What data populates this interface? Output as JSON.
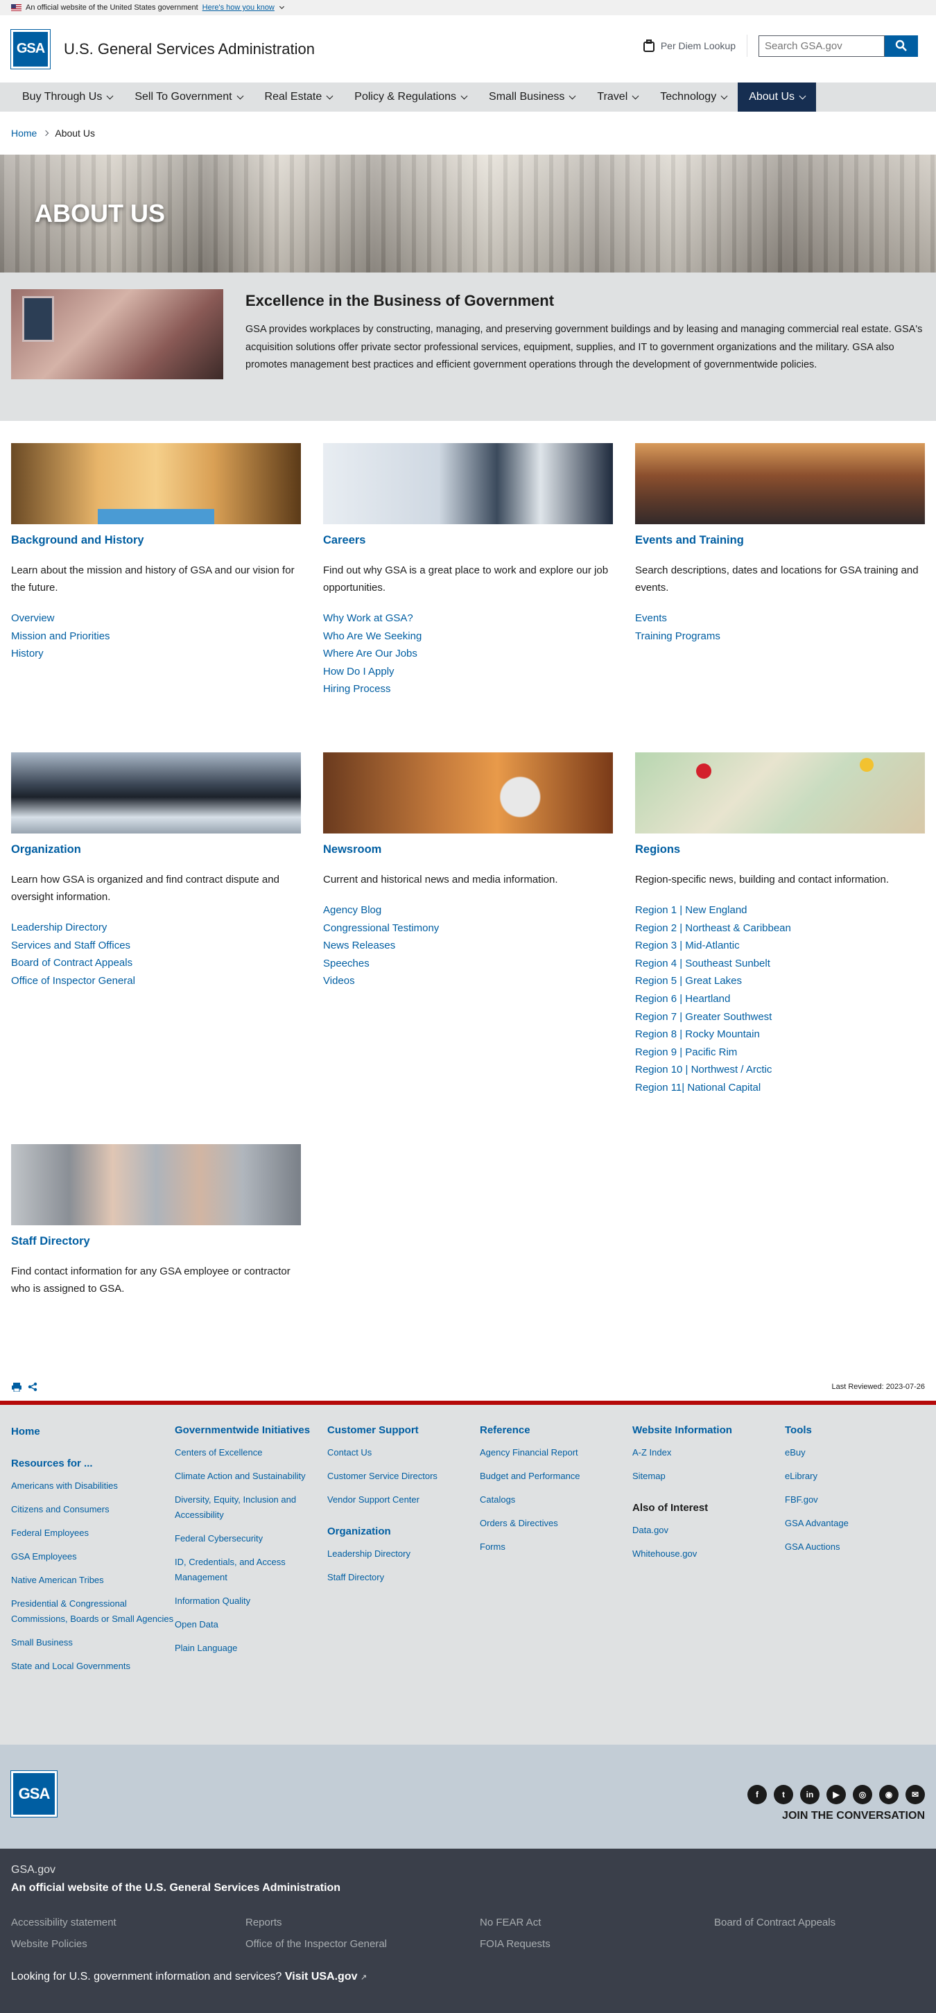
{
  "banner": {
    "text": "An official website of the United States government",
    "how": "Here's how you know"
  },
  "header": {
    "logo": "GSA",
    "title": "U.S. General Services Administration",
    "perdiem": "Per Diem Lookup",
    "search_placeholder": "Search GSA.gov"
  },
  "nav": [
    {
      "label": "Buy Through Us"
    },
    {
      "label": "Sell To Government"
    },
    {
      "label": "Real Estate"
    },
    {
      "label": "Policy & Regulations"
    },
    {
      "label": "Small Business"
    },
    {
      "label": "Travel"
    },
    {
      "label": "Technology"
    },
    {
      "label": "About Us",
      "active": true
    }
  ],
  "breadcrumb": {
    "home": "Home",
    "current": "About Us"
  },
  "hero": {
    "title": "ABOUT US"
  },
  "intro": {
    "heading": "Excellence in the Business of Government",
    "body": "GSA provides workplaces by constructing, managing, and preserving government buildings and by leasing and managing commercial real estate. GSA's acquisition solutions offer private sector professional services, equipment, supplies, and IT to government organizations and the military. GSA also promotes management best practices and efficient government operations through the development of governmentwide policies."
  },
  "cards": [
    {
      "title": "Background and History",
      "desc": "Learn about the mission and history of GSA and our vision for the future.",
      "links": [
        "Overview",
        "Mission and Priorities",
        "History"
      ]
    },
    {
      "title": "Careers",
      "desc": "Find out why GSA is a great place to work and explore our job opportunities.",
      "links": [
        "Why Work at GSA?",
        "Who Are We Seeking",
        "Where Are Our Jobs",
        "How Do I Apply",
        "Hiring Process"
      ]
    },
    {
      "title": "Events and Training",
      "desc": "Search descriptions, dates and locations for GSA training and events.",
      "links": [
        "Events",
        "Training Programs"
      ]
    },
    {
      "title": "Organization",
      "desc": "Learn how GSA is organized and find contract dispute and oversight information.",
      "links": [
        "Leadership Directory",
        "Services and Staff Offices",
        "Board of Contract Appeals",
        "Office of Inspector General"
      ]
    },
    {
      "title": "Newsroom",
      "desc": "Current and historical news and media information.",
      "links": [
        "Agency Blog",
        "Congressional Testimony",
        "News Releases",
        "Speeches",
        "Videos"
      ]
    },
    {
      "title": "Regions",
      "desc": "Region-specific news, building and contact information.",
      "links": [
        "Region 1 | New England",
        "Region 2 | Northeast & Caribbean",
        "Region 3 | Mid-Atlantic",
        "Region 4 | Southeast Sunbelt",
        "Region 5 | Great Lakes",
        "Region 6 | Heartland",
        "Region 7 | Greater Southwest",
        "Region 8 | Rocky Mountain",
        "Region 9 | Pacific Rim",
        "Region 10 | Northwest / Arctic",
        "Region 11| National Capital"
      ]
    },
    {
      "title": "Staff Directory",
      "desc": "Find contact information for any GSA employee or contractor who is assigned to GSA.",
      "links": []
    }
  ],
  "util": {
    "last_reviewed": "Last Reviewed: 2023-07-26"
  },
  "footer": {
    "home": "Home",
    "resources_title": "Resources for ...",
    "resources": [
      "Americans with Disabilities",
      "Citizens and Consumers",
      "Federal Employees",
      "GSA Employees",
      "Native American Tribes",
      "Presidential & Congressional Commissions, Boards or Small Agencies",
      "Small Business",
      "State and Local Governments"
    ],
    "gw_title": "Governmentwide Initiatives",
    "gw": [
      "Centers of Excellence",
      "Climate Action and Sustainability",
      "Diversity, Equity, Inclusion and Accessibility",
      "Federal Cybersecurity",
      "ID, Credentials, and Access Management",
      "Information Quality",
      "Open Data",
      "Plain Language"
    ],
    "cs_title": "Customer Support",
    "cs": [
      "Contact Us",
      "Customer Service Directors",
      "Vendor Support Center"
    ],
    "org_title": "Organization",
    "org": [
      "Leadership Directory",
      "Staff Directory"
    ],
    "ref_title": "Reference",
    "ref": [
      "Agency Financial Report",
      "Budget and Performance",
      "Catalogs",
      "Orders & Directives",
      "Forms"
    ],
    "wi_title": "Website Information",
    "wi": [
      "A-Z Index",
      "Sitemap"
    ],
    "aoi_title": "Also of Interest",
    "aoi": [
      "Data.gov",
      "Whitehouse.gov"
    ],
    "tools_title": "Tools",
    "tools": [
      "eBuy",
      "eLibrary",
      "FBF.gov",
      "GSA Advantage",
      "GSA Auctions"
    ]
  },
  "social": {
    "conversation": "JOIN THE CONVERSATION",
    "icons": [
      "facebook-icon",
      "twitter-icon",
      "linkedin-icon",
      "youtube-icon",
      "instagram-icon",
      "rss-icon",
      "email-icon"
    ]
  },
  "identifier": {
    "domain": "GSA.gov",
    "official": "An official website of the U.S. General Services Administration",
    "links": [
      "Accessibility statement",
      "Reports",
      "No FEAR Act",
      "Board of Contract Appeals",
      "Website Policies",
      "Office of the Inspector General",
      "FOIA Requests"
    ],
    "usa_text": "Looking for U.S. government information and services?",
    "usa_link": "Visit USA.gov"
  }
}
